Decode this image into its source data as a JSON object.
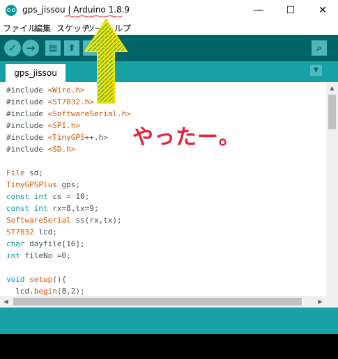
{
  "window": {
    "sketch_name": "gps_jissou",
    "separator": " | ",
    "app_version": "Arduino 1.8.9",
    "minimize": "—",
    "maximize": "☐",
    "close": "✕"
  },
  "menu": [
    "ファイル",
    "編集",
    "スケッチ",
    "ツール",
    "ヘルプ"
  ],
  "toolbar": {
    "verify": "✓",
    "upload": "→",
    "new": "▤",
    "open": "⬆",
    "save": "⬇",
    "serial_monitor": "⌕"
  },
  "tab": {
    "label": "gps_jissou",
    "menu_icon": "▼"
  },
  "code": {
    "lines": [
      {
        "parts": [
          {
            "c": "p",
            "v": "#include "
          },
          {
            "c": "t",
            "v": "<Wire.h>"
          }
        ]
      },
      {
        "parts": [
          {
            "c": "p",
            "v": "#include "
          },
          {
            "c": "t",
            "v": "<ST7032.h>"
          }
        ]
      },
      {
        "parts": [
          {
            "c": "p",
            "v": "#include "
          },
          {
            "c": "t",
            "v": "<SoftwareSerial.h>"
          }
        ]
      },
      {
        "parts": [
          {
            "c": "p",
            "v": "#include "
          },
          {
            "c": "t",
            "v": "<SPI.h>"
          }
        ]
      },
      {
        "parts": [
          {
            "c": "p",
            "v": "#include "
          },
          {
            "c": "t",
            "v": "<TinyGPS"
          },
          {
            "c": "p",
            "v": "++.h>"
          }
        ]
      },
      {
        "parts": [
          {
            "c": "p",
            "v": "#include "
          },
          {
            "c": "t",
            "v": "<SD.h>"
          }
        ]
      },
      {
        "parts": []
      },
      {
        "parts": [
          {
            "c": "t",
            "v": "File"
          },
          {
            "c": "p",
            "v": " sd;"
          }
        ]
      },
      {
        "parts": [
          {
            "c": "t",
            "v": "TinyGPSPlus"
          },
          {
            "c": "p",
            "v": " gps;"
          }
        ]
      },
      {
        "parts": [
          {
            "c": "k",
            "v": "const"
          },
          {
            "c": "p",
            "v": " "
          },
          {
            "c": "k",
            "v": "int"
          },
          {
            "c": "p",
            "v": " cs = 10;"
          }
        ]
      },
      {
        "parts": [
          {
            "c": "k",
            "v": "const"
          },
          {
            "c": "p",
            "v": " "
          },
          {
            "c": "k",
            "v": "int"
          },
          {
            "c": "p",
            "v": " rx=8,tx=9;"
          }
        ]
      },
      {
        "parts": [
          {
            "c": "t",
            "v": "SoftwareSerial"
          },
          {
            "c": "p",
            "v": " ss(rx,tx);"
          }
        ]
      },
      {
        "parts": [
          {
            "c": "t",
            "v": "ST7032"
          },
          {
            "c": "p",
            "v": " lcd;"
          }
        ]
      },
      {
        "parts": [
          {
            "c": "k",
            "v": "char"
          },
          {
            "c": "p",
            "v": " dayfile[16];"
          }
        ]
      },
      {
        "parts": [
          {
            "c": "k",
            "v": "int"
          },
          {
            "c": "p",
            "v": " fileNo =0;"
          }
        ]
      },
      {
        "parts": []
      },
      {
        "parts": [
          {
            "c": "k",
            "v": "void"
          },
          {
            "c": "p",
            "v": " "
          },
          {
            "c": "t",
            "v": "setup"
          },
          {
            "c": "p",
            "v": "(){"
          }
        ]
      },
      {
        "parts": [
          {
            "c": "p",
            "v": "  lcd."
          },
          {
            "c": "t",
            "v": "begin"
          },
          {
            "c": "p",
            "v": "(8,2);"
          }
        ]
      }
    ]
  },
  "annotation": {
    "text": "やったー。",
    "color": "#e8203a"
  },
  "colors": {
    "toolbar": "#006468",
    "tab_bar": "#17a1a5",
    "button": "#4db7bb",
    "arrow": "#f2e600"
  }
}
